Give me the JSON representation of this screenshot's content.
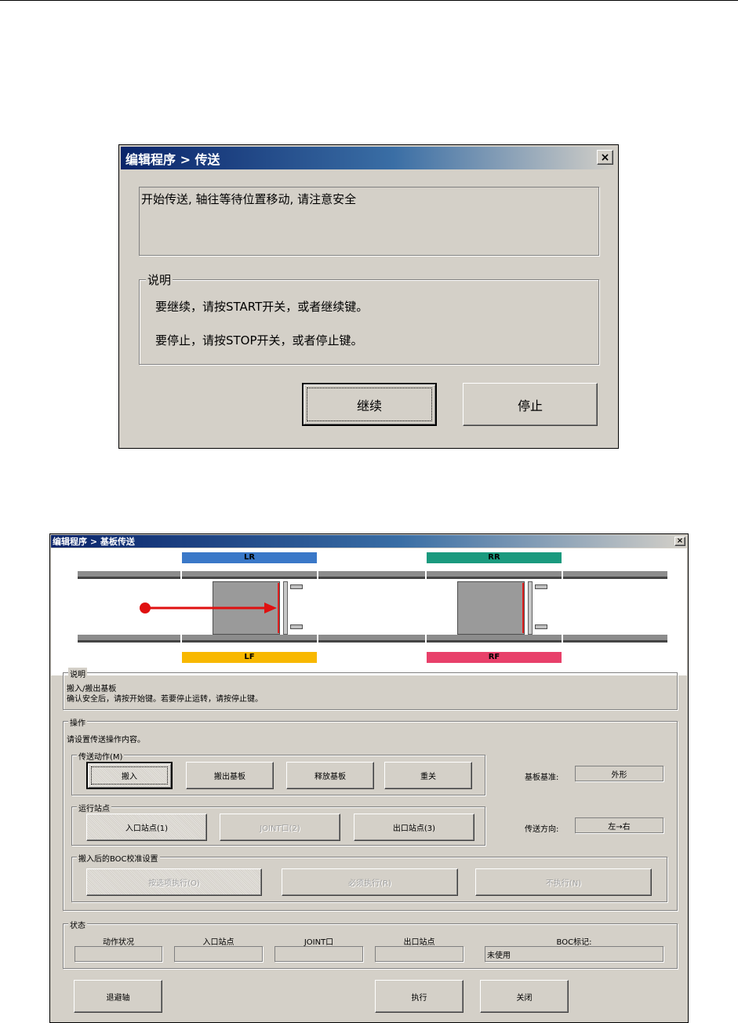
{
  "dialog1": {
    "title": "编辑程序 > 传送",
    "close_glyph": "×",
    "message": "开始传送, 轴往等待位置移动,  请注意安全",
    "explain": {
      "label": "说明",
      "line1": "要继续，请按START开关，或者继续键。",
      "line2": "要停止，请按STOP开关，或者停止键。"
    },
    "buttons": {
      "continue": "继续",
      "stop": "停止"
    }
  },
  "dialog2": {
    "title": "编辑程序 > 基板传送",
    "close_glyph": "×",
    "zones": [
      {
        "label": "LR",
        "color": "#3a78c8"
      },
      {
        "label": "RR",
        "color": "#1a9a7e"
      },
      {
        "label": "LF",
        "color": "#f8b800"
      },
      {
        "label": "RF",
        "color": "#e8406a"
      }
    ],
    "arrow_color": "#e01010",
    "explain": {
      "label": "说明",
      "line1": "搬入/搬出基板",
      "line2": "确认安全后，请按开始键。若要停止运转，请按停止键。"
    },
    "operation": {
      "label": "操作",
      "prompt": "请设置传送操作内容。",
      "transfer_action": {
        "label": "传送动作(M)",
        "buttons": [
          "搬入",
          "搬出基板",
          "释放基板",
          "重关"
        ]
      },
      "board_reference": {
        "label": "基板基准:",
        "value": "外形"
      },
      "run_station": {
        "label": "运行站点",
        "buttons": [
          "入口站点(1)",
          "JOINT口(2)",
          "出口站点(3)"
        ]
      },
      "direction": {
        "label": "传送方向:",
        "value": "左→右"
      },
      "boc": {
        "label": "搬入后的BOC校准设置",
        "buttons": [
          "按选项执行(O)",
          "必须执行(R)",
          "不执行(N)"
        ]
      }
    },
    "status": {
      "label": "状态",
      "columns": [
        "动作状况",
        "入口站点",
        "JOINT口",
        "出口站点",
        "BOC标记:"
      ],
      "values": [
        "",
        "",
        "",
        "",
        "未使用"
      ]
    },
    "footer": {
      "retreat": "退避轴",
      "execute": "执行",
      "close": "关闭"
    }
  }
}
